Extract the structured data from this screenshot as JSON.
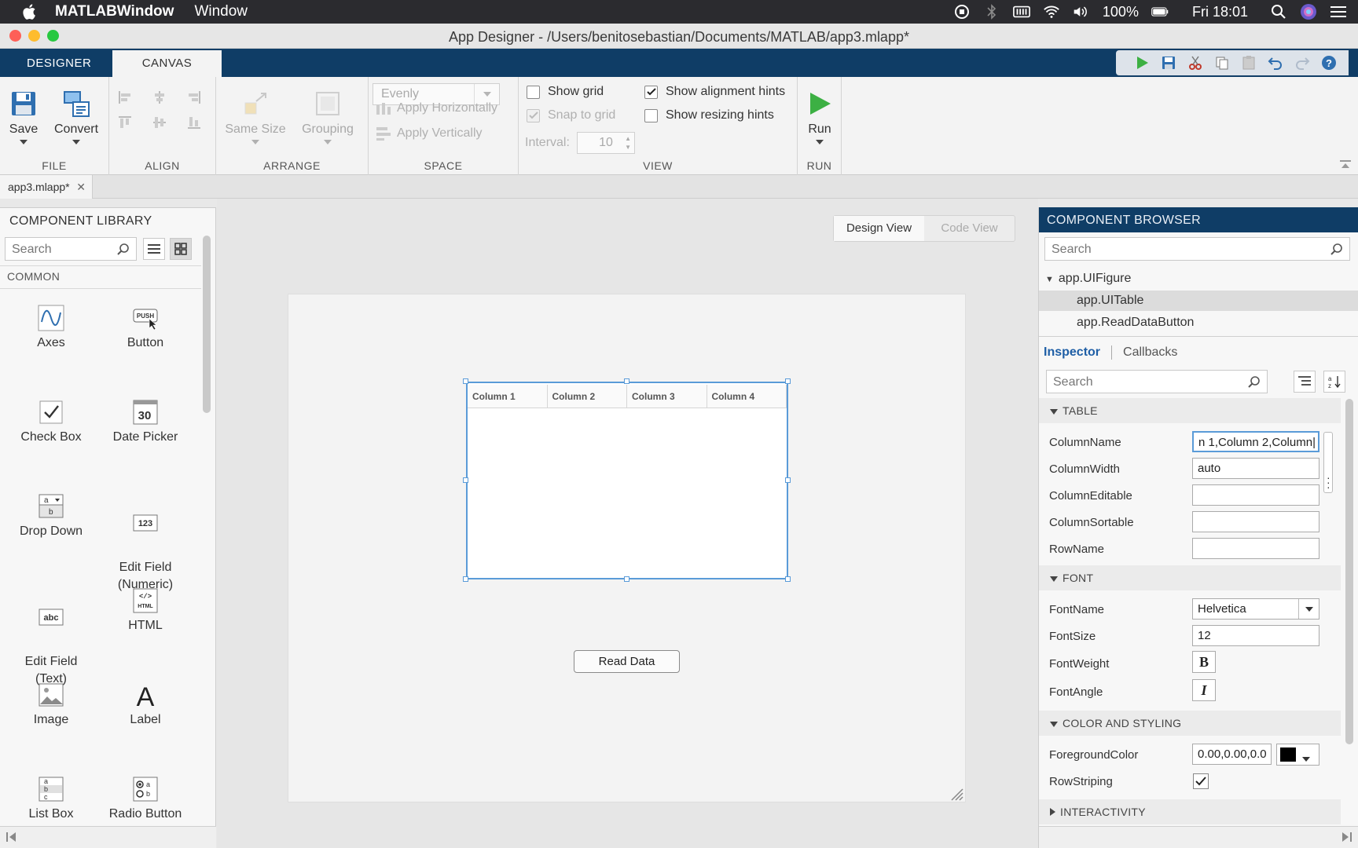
{
  "menubar": {
    "app_name": "MATLABWindow",
    "menus": [
      "Window"
    ],
    "battery": "100%",
    "clock": "Fri 18:01"
  },
  "window": {
    "title": "App Designer - /Users/benitosebastian/Documents/MATLAB/app3.mlapp*"
  },
  "toolstrip": {
    "tabs": [
      "DESIGNER",
      "CANVAS"
    ],
    "active_tab": "CANVAS"
  },
  "ribbon": {
    "file": {
      "label": "FILE",
      "save": "Save",
      "convert": "Convert"
    },
    "align": {
      "label": "ALIGN"
    },
    "arrange": {
      "label": "ARRANGE",
      "same_size": "Same Size",
      "grouping": "Grouping"
    },
    "space": {
      "label": "SPACE",
      "dropdown": "Evenly",
      "apply_h": "Apply Horizontally",
      "apply_v": "Apply Vertically"
    },
    "view": {
      "label": "VIEW",
      "show_grid": "Show grid",
      "snap_to_grid": "Snap to grid",
      "interval_label": "Interval:",
      "interval_value": "10",
      "show_alignment_hints": "Show alignment hints",
      "show_resizing_hints": "Show resizing hints"
    },
    "run": {
      "label": "RUN",
      "run": "Run"
    }
  },
  "document_tab": {
    "name": "app3.mlapp*"
  },
  "component_library": {
    "title": "COMPONENT LIBRARY",
    "search_placeholder": "Search",
    "section": "COMMON",
    "items": [
      {
        "label": "Axes"
      },
      {
        "label": "Button"
      },
      {
        "label": "Check Box"
      },
      {
        "label": "Date Picker"
      },
      {
        "label": "Drop Down"
      },
      {
        "label": "Edit Field\n(Numeric)"
      },
      {
        "label": "Edit Field\n(Text)"
      },
      {
        "label": "HTML"
      },
      {
        "label": "Image"
      },
      {
        "label": "Label"
      },
      {
        "label": "List Box"
      },
      {
        "label": "Radio Button"
      }
    ],
    "icon_text": {
      "push": "PUSH",
      "date": "30",
      "numeric": "123",
      "text": "abc",
      "html": "HTML"
    }
  },
  "canvas": {
    "design_view": "Design View",
    "code_view": "Code View",
    "table_columns": [
      "Column 1",
      "Column 2",
      "Column 3",
      "Column 4"
    ],
    "button_label": "Read Data"
  },
  "component_browser": {
    "title": "COMPONENT BROWSER",
    "search_placeholder": "Search",
    "tree": [
      "app.UIFigure",
      "app.UITable",
      "app.ReadDataButton"
    ],
    "inspector_tab": "Inspector",
    "callbacks_tab": "Callbacks",
    "inspector_search_placeholder": "Search",
    "sections": {
      "table": "TABLE",
      "font": "FONT",
      "color": "COLOR AND STYLING",
      "interactivity": "INTERACTIVITY"
    },
    "props": {
      "column_name": {
        "label": "ColumnName",
        "value": "n 1,Column 2,Column|"
      },
      "column_width": {
        "label": "ColumnWidth",
        "value": "auto"
      },
      "column_editable": {
        "label": "ColumnEditable",
        "value": ""
      },
      "column_sortable": {
        "label": "ColumnSortable",
        "value": ""
      },
      "row_name": {
        "label": "RowName",
        "value": ""
      },
      "font_name": {
        "label": "FontName",
        "value": "Helvetica"
      },
      "font_size": {
        "label": "FontSize",
        "value": "12"
      },
      "font_weight": {
        "label": "FontWeight",
        "value": "B"
      },
      "font_angle": {
        "label": "FontAngle",
        "value": "I"
      },
      "foreground": {
        "label": "ForegroundColor",
        "value": "0.00,0.00,0.0",
        "swatch": "#000000"
      },
      "row_striping": {
        "label": "RowStriping",
        "checked": true
      }
    }
  },
  "colors": {
    "toolstrip_blue": "#0f3d66",
    "selection_blue": "#5a9bd8",
    "run_green": "#3cb043"
  }
}
